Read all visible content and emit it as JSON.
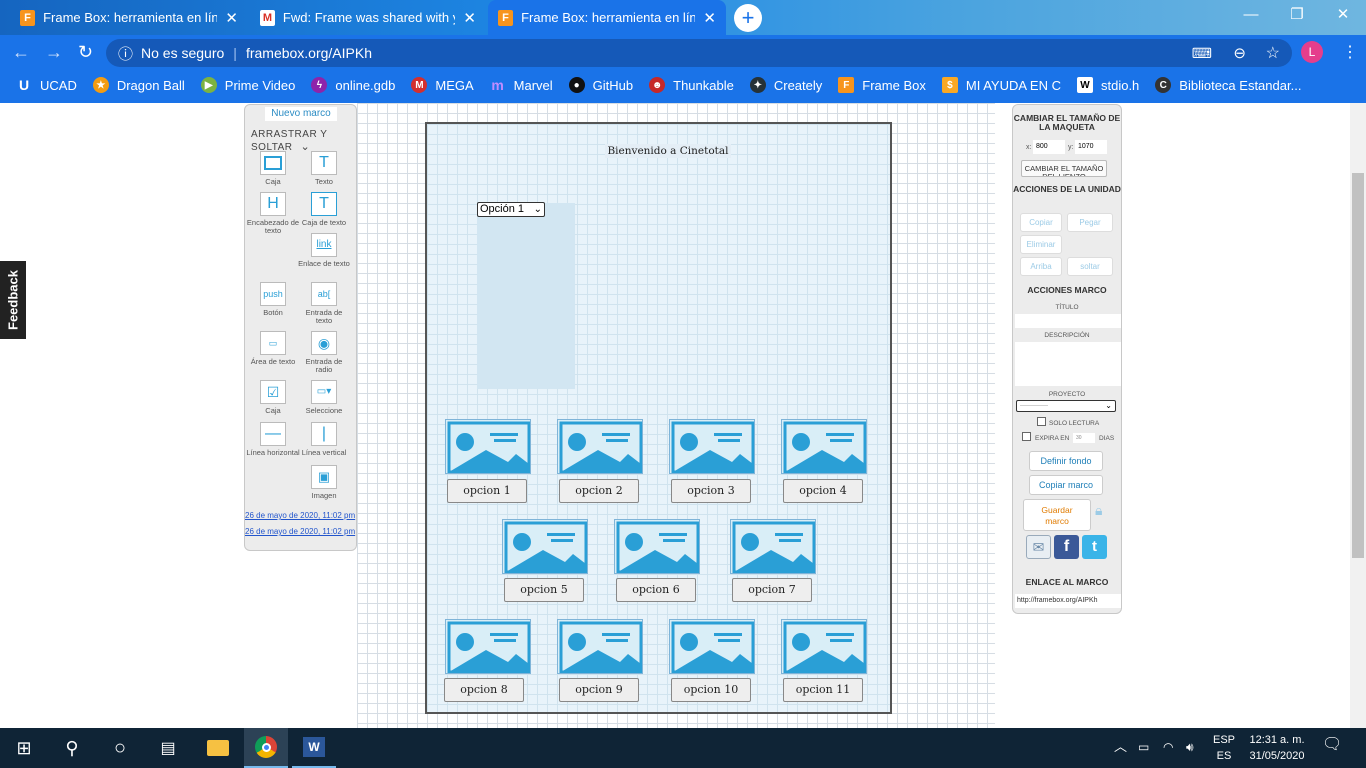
{
  "tabs": [
    {
      "title": "Frame Box: herramienta en línea",
      "active": false
    },
    {
      "title": "Fwd: Frame was shared with you",
      "active": false
    },
    {
      "title": "Frame Box: herramienta en línea",
      "active": true
    }
  ],
  "address": {
    "security": "No es seguro",
    "url": "framebox.org/AIPKh",
    "profile": "L"
  },
  "bookmarks": [
    "UCAD",
    "Dragon Ball",
    "Prime Video",
    "online.gdb",
    "MEGA",
    "Marvel",
    "GitHub",
    "Thunkable",
    "Creately",
    "Frame Box",
    "MI AYUDA EN C",
    "stdio.h",
    "Biblioteca Estandar..."
  ],
  "feedback": "Feedback",
  "left_panel": {
    "new_frame": "Nuevo marco",
    "drag_drop": "ARRASTRAR Y SOLTAR",
    "tools": {
      "box": "Caja",
      "text": "Texto",
      "heading": "Encabezado de texto",
      "textbox": "Caja de texto",
      "link": "Enlace de texto",
      "button": "Botón",
      "text_input": "Entrada de texto",
      "textarea": "Área de texto",
      "radio": "Entrada de radio",
      "checkbox": "Caja",
      "select": "Seleccione",
      "hline": "Línea horizontal",
      "vline": "Línea vertical",
      "image": "Imagen"
    },
    "dates": [
      "26 de mayo de 2020, 11:02 pm",
      "26 de mayo de 2020, 11:02 pm"
    ]
  },
  "canvas": {
    "welcome": "Bienvenido a Cinetotal",
    "select_value": "Opción 1",
    "buttons": [
      "opcion 1",
      "opcion 2",
      "opcion 3",
      "opcion 4",
      "opcion 5",
      "opcion 6",
      "opcion 7",
      "opcion 8",
      "opcion 9",
      "opcion 10",
      "opcion 11"
    ]
  },
  "right_panel": {
    "resize_title": "CAMBIAR EL TAMAÑO DE LA MAQUETA",
    "x_label": "x:",
    "x_value": "800",
    "y_label": "y:",
    "y_value": "1070",
    "resize_button": "CAMBIAR EL TAMAÑO DEL LIENZO",
    "unit_actions": "ACCIONES DE LA UNIDAD",
    "copy": "Copiar",
    "paste": "Pegar",
    "delete": "Eliminar",
    "up": "Arriba",
    "drop": "soltar",
    "frame_actions": "ACCIONES MARCO",
    "title_label": "TÍTULO",
    "description_label": "DESCRIPCIÓN",
    "project_label": "PROYECTO",
    "project_value": "--------------",
    "read_only": "SOLO LECTURA",
    "expires_in": "EXPIRA EN",
    "expires_value": "30",
    "days": "DIAS",
    "set_background": "Definir fondo",
    "copy_frame": "Copiar marco",
    "save_frame": "Guardar marco",
    "frame_link_title": "ENLACE AL MARCO",
    "frame_link": "http://framebox.org/AIPKh"
  },
  "taskbar": {
    "lang1": "ESP",
    "lang2": "ES",
    "time": "12:31 a. m.",
    "date": "31/05/2020"
  }
}
